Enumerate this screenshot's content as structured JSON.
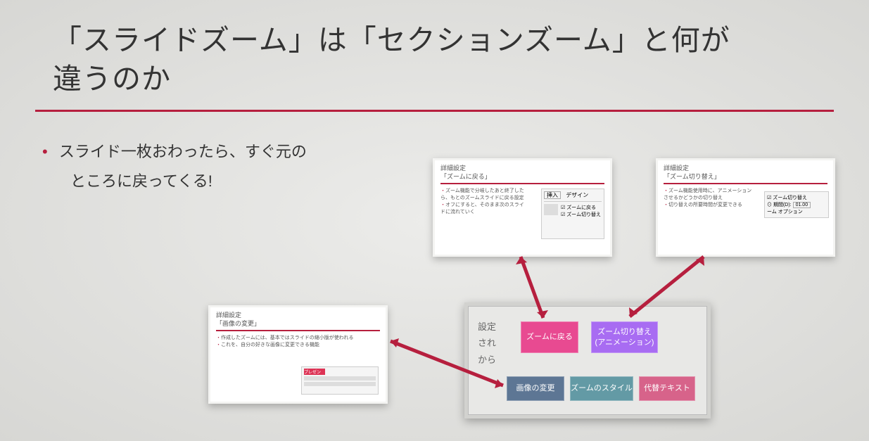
{
  "title_line1": "「スライドズーム」は「セクションズーム」と何が",
  "title_line2": "違うのか",
  "bullet_line1": "スライド一枚おわったら、すぐ元の",
  "bullet_line2": "ところに戻ってくる!",
  "thumb_left": {
    "hdr1": "詳細設定",
    "hdr2": "「画像の変更」",
    "b1": "作成したズームには、基本ではスライドの縮小版が使われる",
    "b2": "これを、自分の好きな画像に変更できる機能",
    "badge": "プレゼン"
  },
  "thumb_top": {
    "hdr1": "詳細設定",
    "hdr2": "「ズームに戻る」",
    "b1": "ズーム機能で分岐したあと終了したら、もとのズームスライドに戻る設定",
    "b2": "オフにすると、そのまま次のスライドに流れていく",
    "tab1": "挿入",
    "tab2": "デザイン",
    "chk1": "ズームに戻る",
    "chk2": "ズーム切り替え"
  },
  "thumb_right": {
    "hdr1": "詳細設定",
    "hdr2": "「ズーム切り替え」",
    "b1": "ズーム機能使用時に、アニメーションさせるかどうかの切り替え",
    "b2": "切り替えの所要時間が変更できる",
    "opt1": "ズーム切り替え",
    "opt2": "期間(D):",
    "opt2v": "01.00",
    "opt3": "ーム オプション"
  },
  "central": {
    "side1": "設定",
    "side2": "され",
    "side3": "から",
    "tile1": "ズームに戻る",
    "tile2_l1": "ズーム切り替え",
    "tile2_l2": "(アニメーション)",
    "tile3": "画像の変更",
    "tile4": "ズームのスタイル",
    "tile5": "代替テキスト"
  },
  "colors": {
    "pink": "#e84a91",
    "purple": "#a86cf2",
    "slate": "#5d7694",
    "teal": "#639aa5",
    "rose": "#d7638a"
  }
}
